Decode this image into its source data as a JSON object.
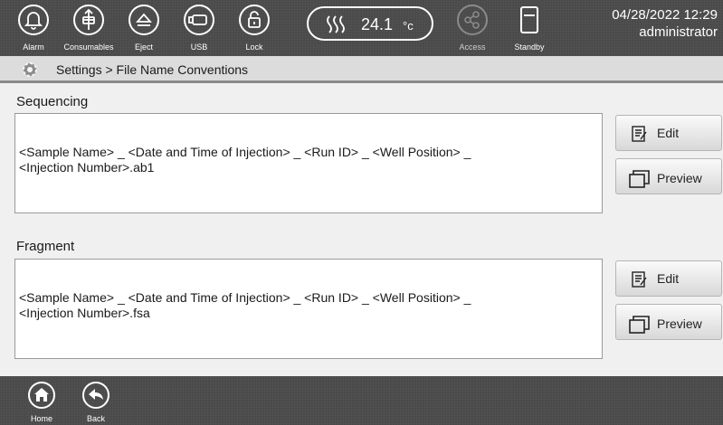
{
  "toolbar": {
    "buttons": [
      {
        "label": "Alarm",
        "icon": "bell-icon"
      },
      {
        "label": "Consumables",
        "icon": "consumables-icon"
      },
      {
        "label": "Eject",
        "icon": "eject-icon"
      },
      {
        "label": "USB",
        "icon": "usb-icon"
      },
      {
        "label": "Lock",
        "icon": "lock-icon"
      },
      {
        "label": "Access",
        "icon": "share-icon"
      },
      {
        "label": "Standby",
        "icon": "standby-icon"
      }
    ],
    "temperature": {
      "value": "24.1",
      "unit": "°c",
      "icon": "heat-waves-icon"
    },
    "date_time": "04/28/2022 12:29",
    "user": "administrator"
  },
  "breadcrumb": {
    "text": "Settings > File Name Conventions",
    "icon": "gear-icon"
  },
  "sections": [
    {
      "label": "Sequencing",
      "line1": "<Sample Name> _ <Date and Time of Injection> _ <Run ID> _ <Well Position> _",
      "line2": "<Injection Number>.ab1",
      "edit_label": "Edit",
      "preview_label": "Preview"
    },
    {
      "label": "Fragment",
      "line1": "<Sample Name> _ <Date and Time of Injection> _ <Run ID> _ <Well Position> _",
      "line2": "<Injection Number>.fsa",
      "edit_label": "Edit",
      "preview_label": "Preview"
    }
  ],
  "bottom_nav": [
    {
      "label": "Home",
      "icon": "home-icon"
    },
    {
      "label": "Back",
      "icon": "back-arrow-icon"
    }
  ],
  "colors": {
    "toolbar_bg": "#4a4a4a",
    "crumb_bg": "#dcdcdc",
    "content_bg": "#f0f0f0"
  }
}
